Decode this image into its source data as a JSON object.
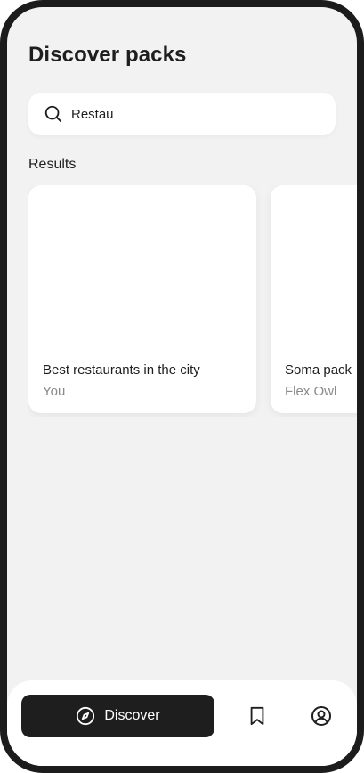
{
  "header": {
    "title": "Discover packs"
  },
  "search": {
    "value": "Restau",
    "icon": "search-icon"
  },
  "results": {
    "heading": "Results",
    "cards": [
      {
        "title": "Best restaurants in the city",
        "author": "You"
      },
      {
        "title": "Soma pack",
        "author": "Flex Owl"
      }
    ]
  },
  "bottom_nav": {
    "items": [
      {
        "label": "Discover",
        "icon": "compass-icon",
        "active": true
      },
      {
        "label": "",
        "icon": "bookmark-icon",
        "active": false
      },
      {
        "label": "",
        "icon": "profile-icon",
        "active": false
      }
    ]
  },
  "colors": {
    "background": "#f2f2f2",
    "surface": "#ffffff",
    "text_primary": "#1e1e1e",
    "text_secondary": "#8a8a8a",
    "active_nav": "#1e1e1e",
    "device_frame": "#1c1c1c"
  }
}
